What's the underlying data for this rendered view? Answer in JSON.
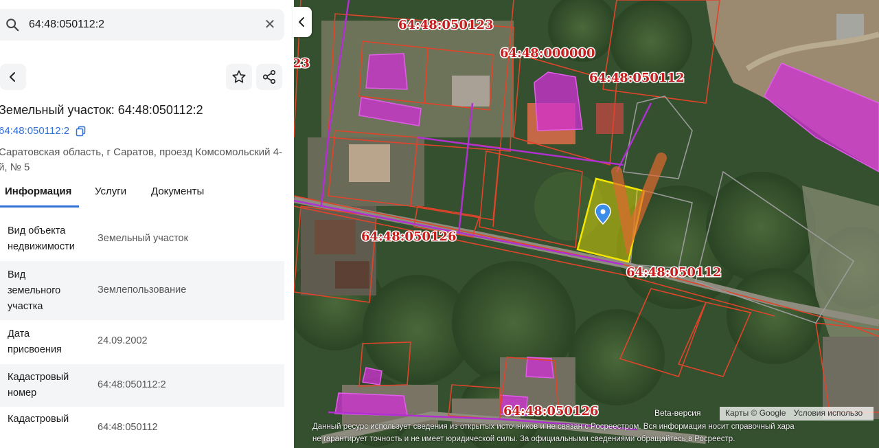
{
  "search": {
    "value": "64:48:050112:2"
  },
  "card": {
    "title": "Земельный участок: 64:48:050112:2",
    "cad_number": "64:48:050112:2",
    "address": "Саратовская область, г Саратов, проезд Комсомольский 4-й, № 5"
  },
  "tabs": [
    {
      "label": "Информация"
    },
    {
      "label": "Услуги"
    },
    {
      "label": "Документы"
    }
  ],
  "rows": [
    {
      "label": "Вид объекта недвижимости",
      "value": "Земельный участок"
    },
    {
      "label": "Вид земельного участка",
      "value": "Землепользование"
    },
    {
      "label": "Дата присвоения",
      "value": "24.09.2002"
    },
    {
      "label": "Кадастровый номер",
      "value": "64:48:050112:2"
    },
    {
      "label": "Кадастровый",
      "value": "64:48:050112"
    }
  ],
  "map": {
    "labels": [
      "64:48:050123",
      "64:48:000000",
      "64:48:050112",
      "64:48:050126",
      "64:48:050112",
      "64:48:050126",
      "23"
    ],
    "beta": "Beta-версия",
    "attribution": [
      "Карты © Google",
      "Условия использо"
    ],
    "disclaimer": [
      "Данный ресурс использует сведения из открытых источников и не связан с Росреестром. Вся информация носит справочный хара",
      "не гарантирует точность и не имеет юридической силы. За официальными сведениями обращайтесь в Росреестр."
    ]
  },
  "colors": {
    "accent": "#2f6fd6",
    "parcel_line": "#e0442a",
    "selected_parcel": "#f5e600",
    "building": "#d12fd6"
  }
}
